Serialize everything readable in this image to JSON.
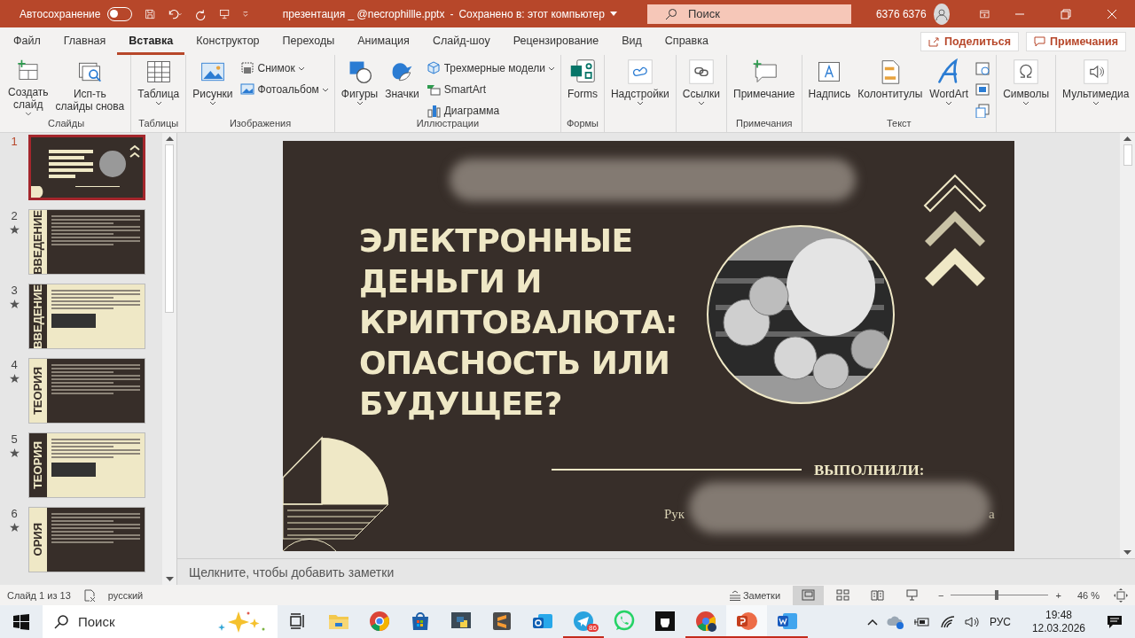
{
  "title_bar": {
    "autosave_label": "Автосохранение",
    "autosave_on": false,
    "document": "презентация _ @necrophillle.pptx",
    "separator": "-",
    "save_status": "Сохранено в: этот компьютер",
    "search": {
      "placeholder": "Поиск"
    },
    "user": "6376 6376"
  },
  "tabs": [
    {
      "label": "Файл",
      "selected": false
    },
    {
      "label": "Главная",
      "selected": false
    },
    {
      "label": "Вставка",
      "selected": true
    },
    {
      "label": "Конструктор",
      "selected": false
    },
    {
      "label": "Переходы",
      "selected": false
    },
    {
      "label": "Анимация",
      "selected": false
    },
    {
      "label": "Слайд-шоу",
      "selected": false
    },
    {
      "label": "Рецензирование",
      "selected": false
    },
    {
      "label": "Вид",
      "selected": false
    },
    {
      "label": "Справка",
      "selected": false
    }
  ],
  "share_button": "Поделиться",
  "comments_button": "Примечания",
  "ribbon": {
    "groups": [
      {
        "label": "Слайды",
        "items": [
          {
            "kind": "large",
            "lines": [
              "Создать",
              "слайд"
            ],
            "dropdown": true
          },
          {
            "kind": "large",
            "lines": [
              "Исп-ть",
              "слайды снова"
            ],
            "dropdown": false
          }
        ]
      },
      {
        "label": "Таблицы",
        "items": [
          {
            "kind": "large",
            "lines": [
              "Таблица"
            ],
            "dropdown": true
          }
        ]
      },
      {
        "label": "Изображения",
        "items": [
          {
            "kind": "large",
            "lines": [
              "Рисунки"
            ],
            "dropdown": true
          },
          {
            "kind": "small",
            "label": "Снимок",
            "dropdown": true
          },
          {
            "kind": "small",
            "label": "Фотоальбом",
            "dropdown": true
          }
        ]
      },
      {
        "label": "Иллюстрации",
        "items": [
          {
            "kind": "large",
            "lines": [
              "Фигуры"
            ],
            "dropdown": true
          },
          {
            "kind": "large",
            "lines": [
              "Значки"
            ],
            "dropdown": false
          },
          {
            "kind": "small",
            "label": "Трехмерные модели",
            "dropdown": true
          },
          {
            "kind": "small",
            "label": "SmartArt",
            "dropdown": false
          },
          {
            "kind": "small",
            "label": "Диаграмма",
            "dropdown": false
          }
        ]
      },
      {
        "label": "Формы",
        "items": [
          {
            "kind": "large",
            "lines": [
              "Forms"
            ],
            "dropdown": false
          }
        ]
      },
      {
        "items": [
          {
            "kind": "large",
            "lines": [
              "Надстройки"
            ],
            "dropdown": true
          }
        ]
      },
      {
        "items": [
          {
            "kind": "large",
            "lines": [
              "Ссылки"
            ],
            "dropdown": true
          }
        ]
      },
      {
        "label": "Примечания",
        "items": [
          {
            "kind": "large",
            "lines": [
              "Примечание"
            ],
            "dropdown": false
          }
        ]
      },
      {
        "label": "Текст",
        "items": [
          {
            "kind": "large",
            "lines": [
              "Надпись"
            ],
            "dropdown": false
          },
          {
            "kind": "large",
            "lines": [
              "Колонтитулы"
            ],
            "dropdown": false
          },
          {
            "kind": "large",
            "lines": [
              "WordArt"
            ],
            "dropdown": true
          },
          {
            "kind": "icon"
          },
          {
            "kind": "icon"
          },
          {
            "kind": "icon"
          }
        ]
      },
      {
        "items": [
          {
            "kind": "large",
            "lines": [
              "Символы"
            ],
            "dropdown": true
          }
        ]
      },
      {
        "items": [
          {
            "kind": "large",
            "lines": [
              "Мультимедиа"
            ],
            "dropdown": true
          }
        ]
      }
    ]
  },
  "slides": [
    {
      "number": "1",
      "kind": "title",
      "selected": true,
      "animated": false
    },
    {
      "number": "2",
      "kind": "dark",
      "label": "ВВЕДЕНИЕ",
      "selected": false,
      "animated": true
    },
    {
      "number": "3",
      "kind": "light",
      "label": "ВВЕДЕНИЕ",
      "selected": false,
      "animated": true
    },
    {
      "number": "4",
      "kind": "dark",
      "label": "ТЕОРИЯ",
      "selected": false,
      "animated": true
    },
    {
      "number": "5",
      "kind": "light",
      "label": "ТЕОРИЯ",
      "selected": false,
      "animated": true
    },
    {
      "number": "6",
      "kind": "dark",
      "label": "ОРИЯ",
      "selected": false,
      "animated": true
    }
  ],
  "slide": {
    "title_lines": [
      "ЭЛЕКТРОННЫЕ",
      "ДЕНЬГИ И",
      "КРИПТОВАЛЮТА:",
      "ОПАСНОСТЬ ИЛИ",
      "БУДУЩЕЕ?"
    ],
    "performed_label": "ВЫПОЛНИЛИ:",
    "supervisor_fragment": "Рук",
    "trailing_fragment": "а"
  },
  "notes_placeholder": "Щелкните, чтобы добавить заметки",
  "status_bar": {
    "slide_counter": "Слайд 1 из 13",
    "language": "русский",
    "notes_button": "Заметки",
    "views": [
      {
        "selected": true
      },
      {
        "selected": false
      },
      {
        "selected": false
      },
      {
        "selected": false
      }
    ],
    "zoom_minus": "−",
    "zoom_plus": "+",
    "zoom": {
      "level": 0.45
    },
    "zoom_percent": "46 %"
  },
  "taskbar": {
    "search": {
      "placeholder": "Поиск"
    },
    "apps": [
      {
        "running": false,
        "active": false
      },
      {
        "running": false,
        "active": false
      },
      {
        "running": false,
        "active": false
      },
      {
        "running": false,
        "active": false
      },
      {
        "running": false,
        "active": false
      },
      {
        "running": false,
        "active": false
      },
      {
        "running": true,
        "active": false,
        "badge": "86"
      },
      {
        "running": false,
        "active": false
      },
      {
        "running": false,
        "active": false
      },
      {
        "running": true,
        "active": false
      },
      {
        "running": true,
        "active": true
      },
      {
        "running": true,
        "active": false
      }
    ],
    "language": "РУС",
    "time": "19:48",
    "date": "12.03.2026"
  }
}
